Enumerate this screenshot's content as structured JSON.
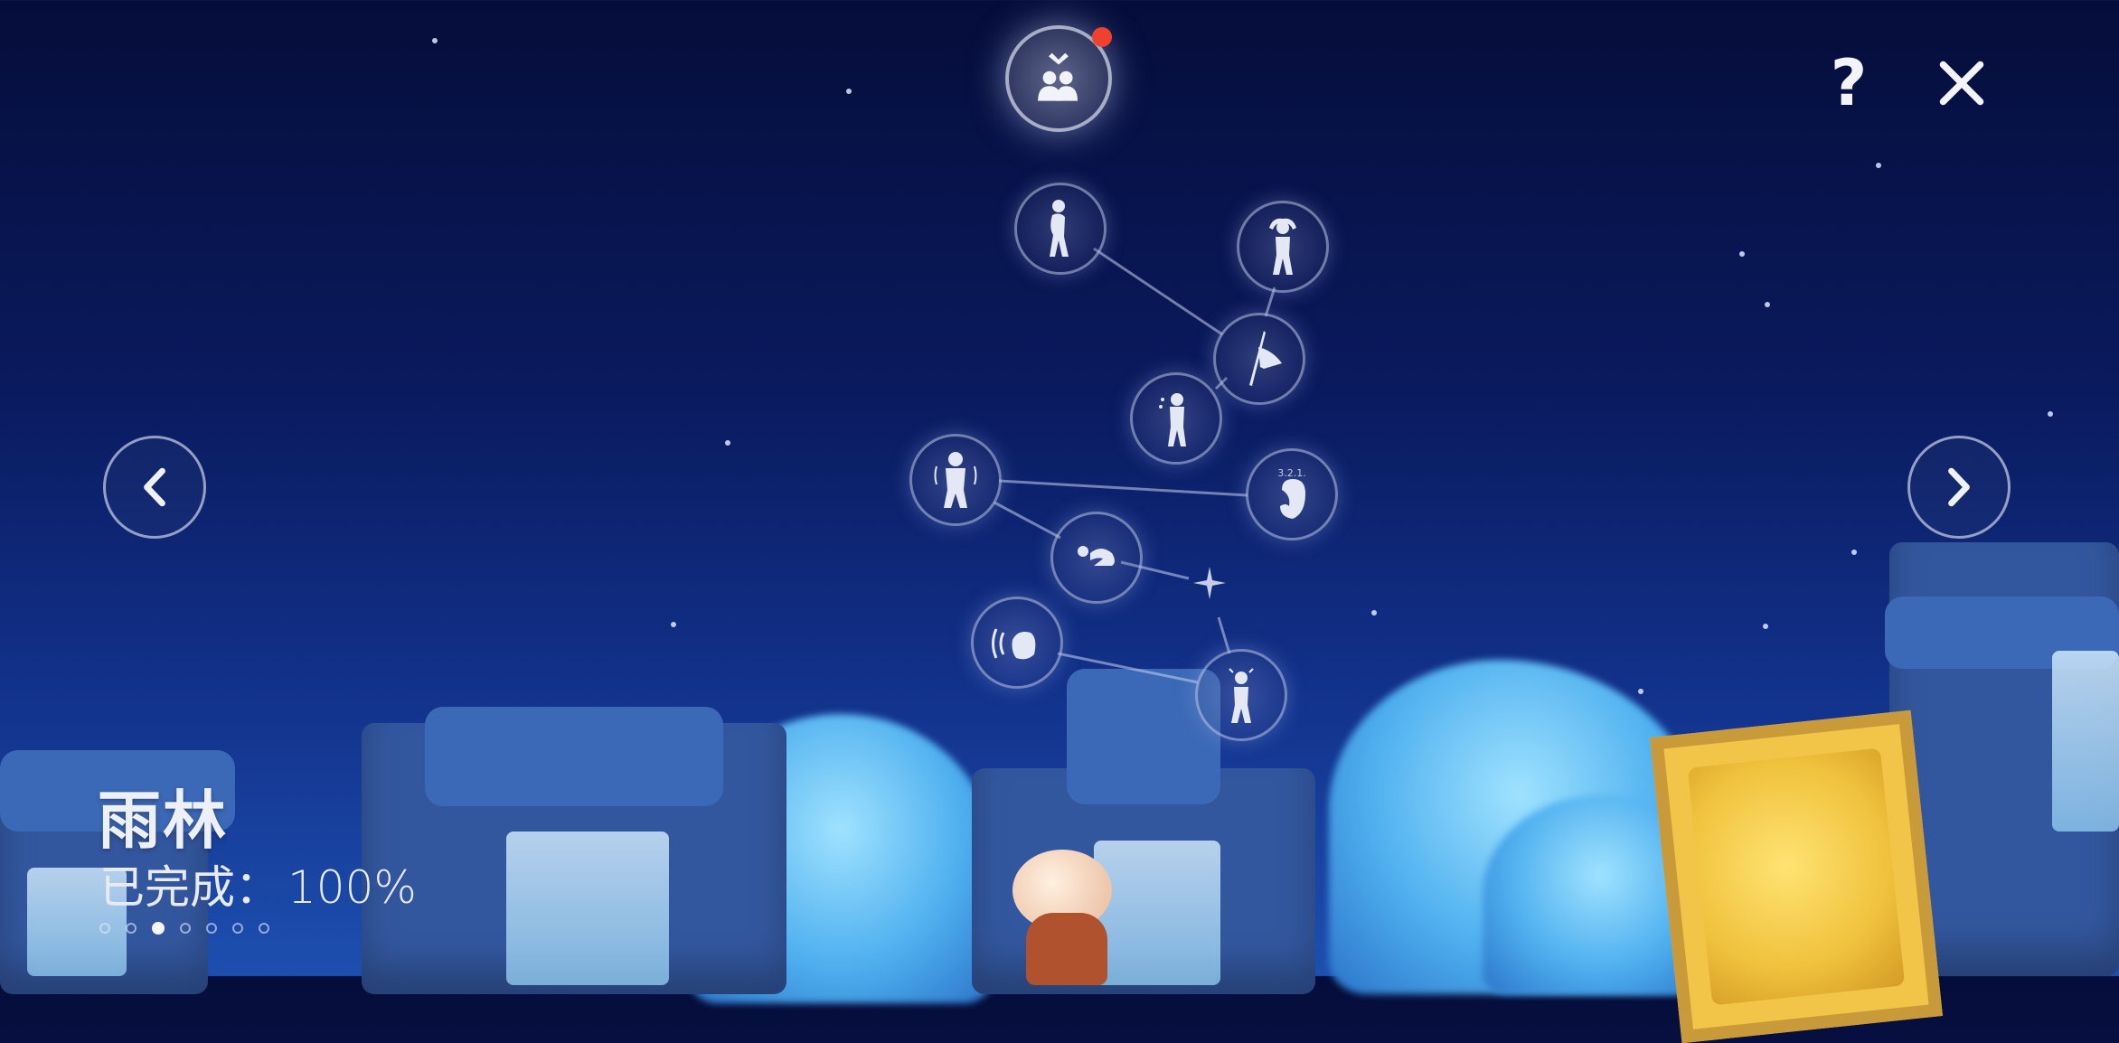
{
  "realm": {
    "name": "雨林",
    "progress_label": "已完成：",
    "progress_value": "100%",
    "progress_fraction": 1.0
  },
  "pagination": {
    "total": 7,
    "active_index": 2
  },
  "top_node": {
    "icon": "friends-icon",
    "has_notification": true
  },
  "buttons": {
    "help_label": "?",
    "close_icon": "close-icon",
    "prev_icon": "chevron-left-icon",
    "next_icon": "chevron-right-icon"
  },
  "constellation": {
    "nodes": [
      {
        "id": "spirit-1",
        "icon": "shy-pose-icon"
      },
      {
        "id": "spirit-2",
        "icon": "hands-on-head-icon"
      },
      {
        "id": "spirit-3",
        "icon": "fishing-net-icon"
      },
      {
        "id": "spirit-4",
        "icon": "crying-pose-icon"
      },
      {
        "id": "spirit-5",
        "icon": "shivering-pose-icon"
      },
      {
        "id": "spirit-6",
        "icon": "countdown-hand-icon",
        "label": "3.2.1."
      },
      {
        "id": "spirit-7",
        "icon": "bow-sleeping-icon"
      },
      {
        "id": "spirit-8",
        "icon": "shout-hand-icon"
      },
      {
        "id": "spirit-9",
        "icon": "angry-pose-icon"
      }
    ],
    "spark_icon": "sparkle-icon"
  },
  "colors": {
    "accent_red": "#f0412f",
    "sky_dark": "#050d3a",
    "sky_light": "#1d4fb0"
  }
}
